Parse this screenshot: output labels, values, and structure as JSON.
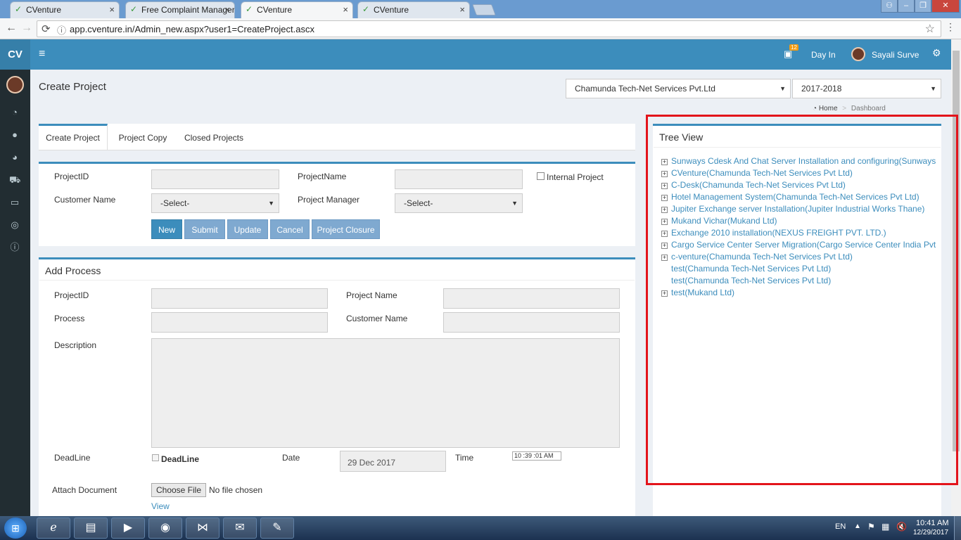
{
  "browser": {
    "tabs": [
      {
        "label": "CVenture"
      },
      {
        "label": "Free Complaint Manager"
      },
      {
        "label": "CVenture"
      },
      {
        "label": "CVenture"
      }
    ],
    "url": "app.cventure.in/Admin_new.aspx?user1=CreateProject.ascx"
  },
  "header": {
    "logo": "CV",
    "notif_count": "12",
    "day_in": "Day In",
    "user_name": "Sayali Surve"
  },
  "page": {
    "title": "Create Project",
    "company": "Chamunda Tech-Net Services Pvt.Ltd",
    "year": "2017-2018",
    "breadcrumb_home": "Home",
    "breadcrumb_current": "Dashboard"
  },
  "tabs": [
    "Create Project",
    "Project Copy",
    "Closed Projects"
  ],
  "project_form": {
    "projectid_label": "ProjectID",
    "projectname_label": "ProjectName",
    "internal_label": "Internal Project",
    "customer_label": "Customer Name",
    "customer_value": "-Select-",
    "manager_label": "Project Manager",
    "manager_value": "-Select-",
    "buttons": {
      "new": "New",
      "submit": "Submit",
      "update": "Update",
      "cancel": "Cancel",
      "closure": "Project Closure"
    }
  },
  "process": {
    "title": "Add Process",
    "projectid_label": "ProjectID",
    "projectname_label": "Project Name",
    "process_label": "Process",
    "customer_label": "Customer Name",
    "description_label": "Description",
    "deadline_label": "DeadLine",
    "deadline_check_label": "DeadLine",
    "date_label": "Date",
    "date_value": "29 Dec 2017",
    "time_label": "Time",
    "time_value": "10 :39 :01  AM",
    "attach_label": "Attach Document",
    "choose_file": "Choose File",
    "no_file": "No file chosen",
    "view_link": "View"
  },
  "tree": {
    "title": "Tree View",
    "items": [
      {
        "text": "Sunways Cdesk And Chat Server Installation and configuring(Sunways (India",
        "expandable": true
      },
      {
        "text": "CVenture(Chamunda Tech-Net Services Pvt Ltd)",
        "expandable": true
      },
      {
        "text": "C-Desk(Chamunda Tech-Net Services Pvt Ltd)",
        "expandable": true
      },
      {
        "text": "Hotel Management System(Chamunda Tech-Net Services Pvt Ltd)",
        "expandable": true
      },
      {
        "text": "Jupiter Exchange server Installation(Jupiter Industrial Works Thane)",
        "expandable": true
      },
      {
        "text": "Mukand Vichar(Mukand Ltd)",
        "expandable": true
      },
      {
        "text": "Exchange 2010 installation(NEXUS FREIGHT PVT. LTD.)",
        "expandable": true
      },
      {
        "text": "Cargo Service Center Server Migration(Cargo Service Center India Pvt. Ltd.)",
        "expandable": true
      },
      {
        "text": "c-venture(Chamunda Tech-Net Services Pvt Ltd)",
        "expandable": true
      },
      {
        "text": "test(Chamunda Tech-Net Services Pvt Ltd)",
        "expandable": false
      },
      {
        "text": "test(Chamunda Tech-Net Services Pvt Ltd)",
        "expandable": false
      },
      {
        "text": "test(Mukand Ltd)",
        "expandable": true
      }
    ]
  },
  "taskbar": {
    "lang": "EN",
    "time": "10:41 AM",
    "date": "12/29/2017"
  },
  "colors": {
    "primary": "#3c8dbc",
    "sidebar": "#222d32",
    "highlight_border": "#e3141b"
  }
}
